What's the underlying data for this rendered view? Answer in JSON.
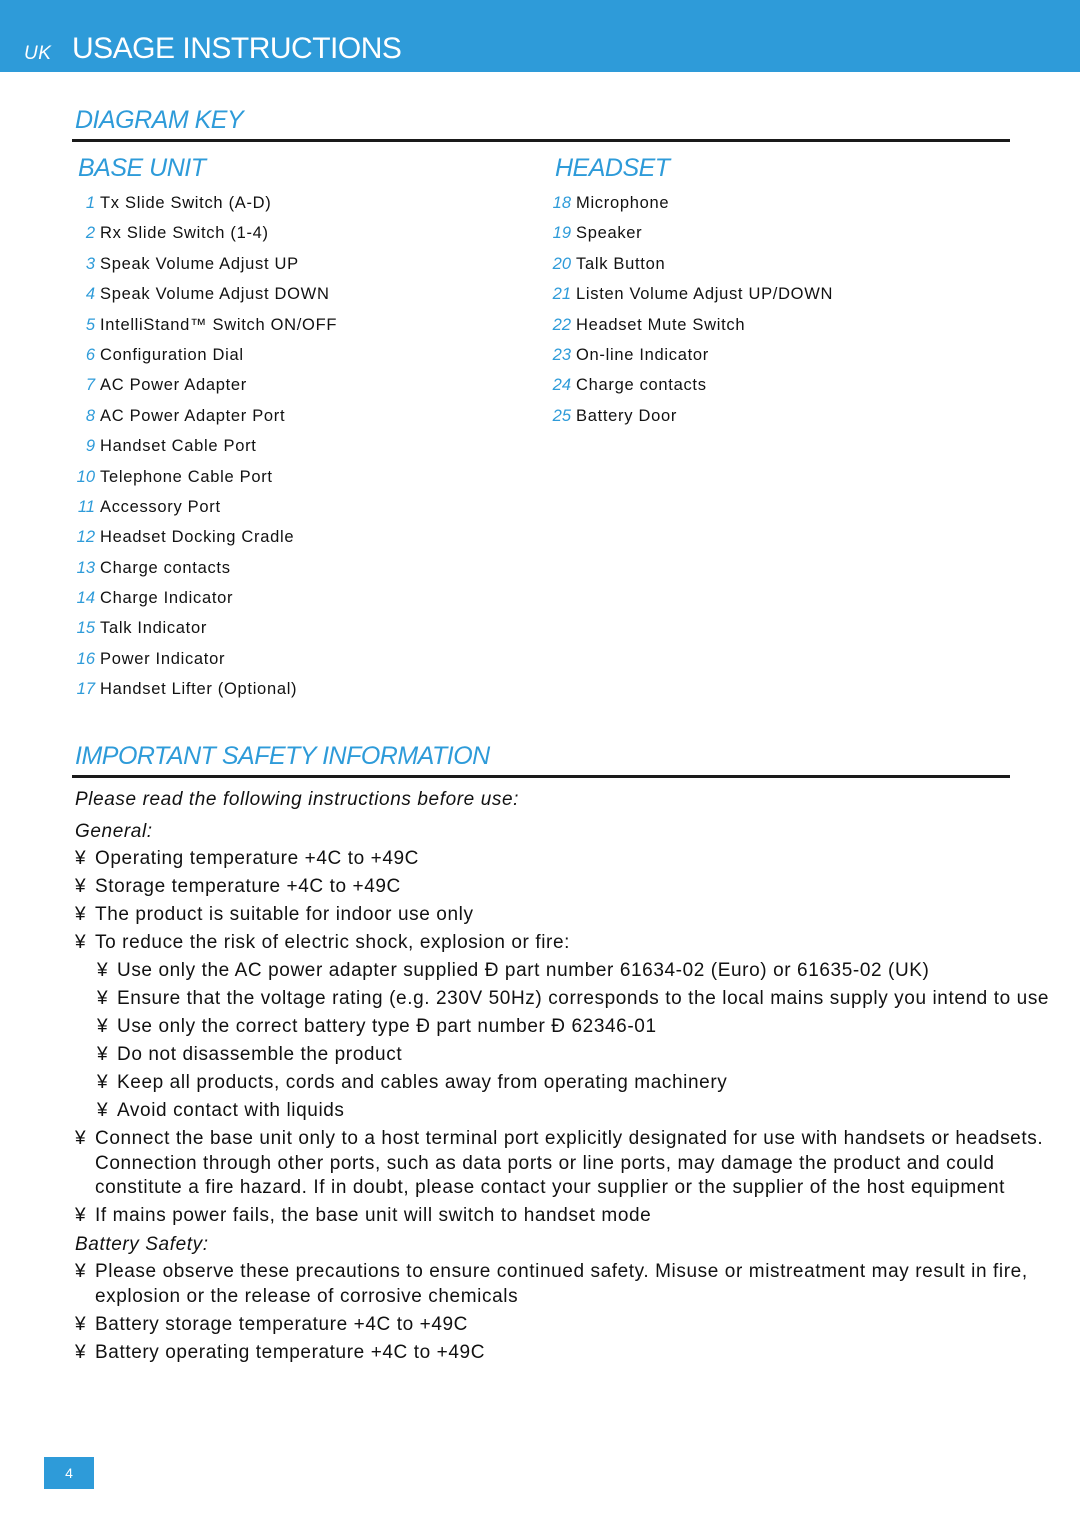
{
  "header": {
    "region": "UK",
    "title": "USAGE INSTRUCTIONS"
  },
  "diagram_key": {
    "title": "DIAGRAM KEY",
    "base_unit": {
      "title": "BASE UNIT",
      "items": [
        {
          "num": "1",
          "label": "Tx Slide Switch (A-D)"
        },
        {
          "num": "2",
          "label": "Rx Slide Switch (1-4)"
        },
        {
          "num": "3",
          "label": "Speak Volume Adjust UP"
        },
        {
          "num": "4",
          "label": "Speak Volume Adjust DOWN"
        },
        {
          "num": "5",
          "label": "IntelliStand™ Switch ON/OFF"
        },
        {
          "num": "6",
          "label": "Configuration Dial"
        },
        {
          "num": "7",
          "label": "AC Power Adapter"
        },
        {
          "num": "8",
          "label": "AC Power Adapter Port"
        },
        {
          "num": "9",
          "label": "Handset Cable Port"
        },
        {
          "num": "10",
          "label": "Telephone Cable Port"
        },
        {
          "num": "11",
          "label": "Accessory Port"
        },
        {
          "num": "12",
          "label": "Headset Docking Cradle"
        },
        {
          "num": "13",
          "label": "Charge contacts"
        },
        {
          "num": "14",
          "label": "Charge Indicator"
        },
        {
          "num": "15",
          "label": "Talk Indicator"
        },
        {
          "num": "16",
          "label": "Power Indicator"
        },
        {
          "num": "17",
          "label": "Handset Lifter (Optional)"
        }
      ]
    },
    "headset": {
      "title": "HEADSET",
      "items": [
        {
          "num": "18",
          "label": "Microphone"
        },
        {
          "num": "19",
          "label": "Speaker"
        },
        {
          "num": "20",
          "label": "Talk Button"
        },
        {
          "num": "21",
          "label": "Listen Volume Adjust UP/DOWN"
        },
        {
          "num": "22",
          "label": "Headset Mute Switch"
        },
        {
          "num": "23",
          "label": "On-line Indicator"
        },
        {
          "num": "24",
          "label": "Charge contacts"
        },
        {
          "num": "25",
          "label": "Battery Door"
        }
      ]
    }
  },
  "safety": {
    "title": "IMPORTANT SAFETY INFORMATION",
    "intro": "Please read the following instructions before use:",
    "general_label": "General:",
    "bullet_glyph": "¥",
    "general": [
      "Operating temperature +4C to +49C",
      "Storage temperature +4C to +49C",
      "The product is suitable for indoor use only",
      "To reduce the risk of electric shock, explosion or fire:"
    ],
    "sub_items": [
      "Use only the AC power adapter supplied Ð part number 61634-02 (Euro) or 61635-02 (UK)",
      "Ensure that the voltage rating (e.g. 230V 50Hz) corresponds to the local mains supply you intend to use",
      "Use only the correct battery type Ð part number Ð 62346-01",
      "Do not disassemble the product",
      "Keep all products, cords and cables away from operating machinery",
      "Avoid contact with liquids"
    ],
    "general_after": [
      "Connect the base unit only to a host terminal port explicitly designated for use with handsets or headsets. Connection through other ports, such as data ports or line ports, may damage the product and could constitute a fire hazard. If in doubt, please contact your supplier or the supplier of the host equipment",
      "If mains power fails, the base unit will switch to handset mode"
    ],
    "battery_label": "Battery Safety:",
    "battery": [
      "Please observe these precautions to ensure continued safety. Misuse or mistreatment may result in fire, explosion or the release of corrosive chemicals",
      "Battery storage temperature +4C to +49C",
      "Battery operating temperature +4C to +49C"
    ]
  },
  "page_number": "4",
  "colors": {
    "accent": "#2e9bd9",
    "text": "#111111",
    "rule": "#1a1a1a"
  }
}
